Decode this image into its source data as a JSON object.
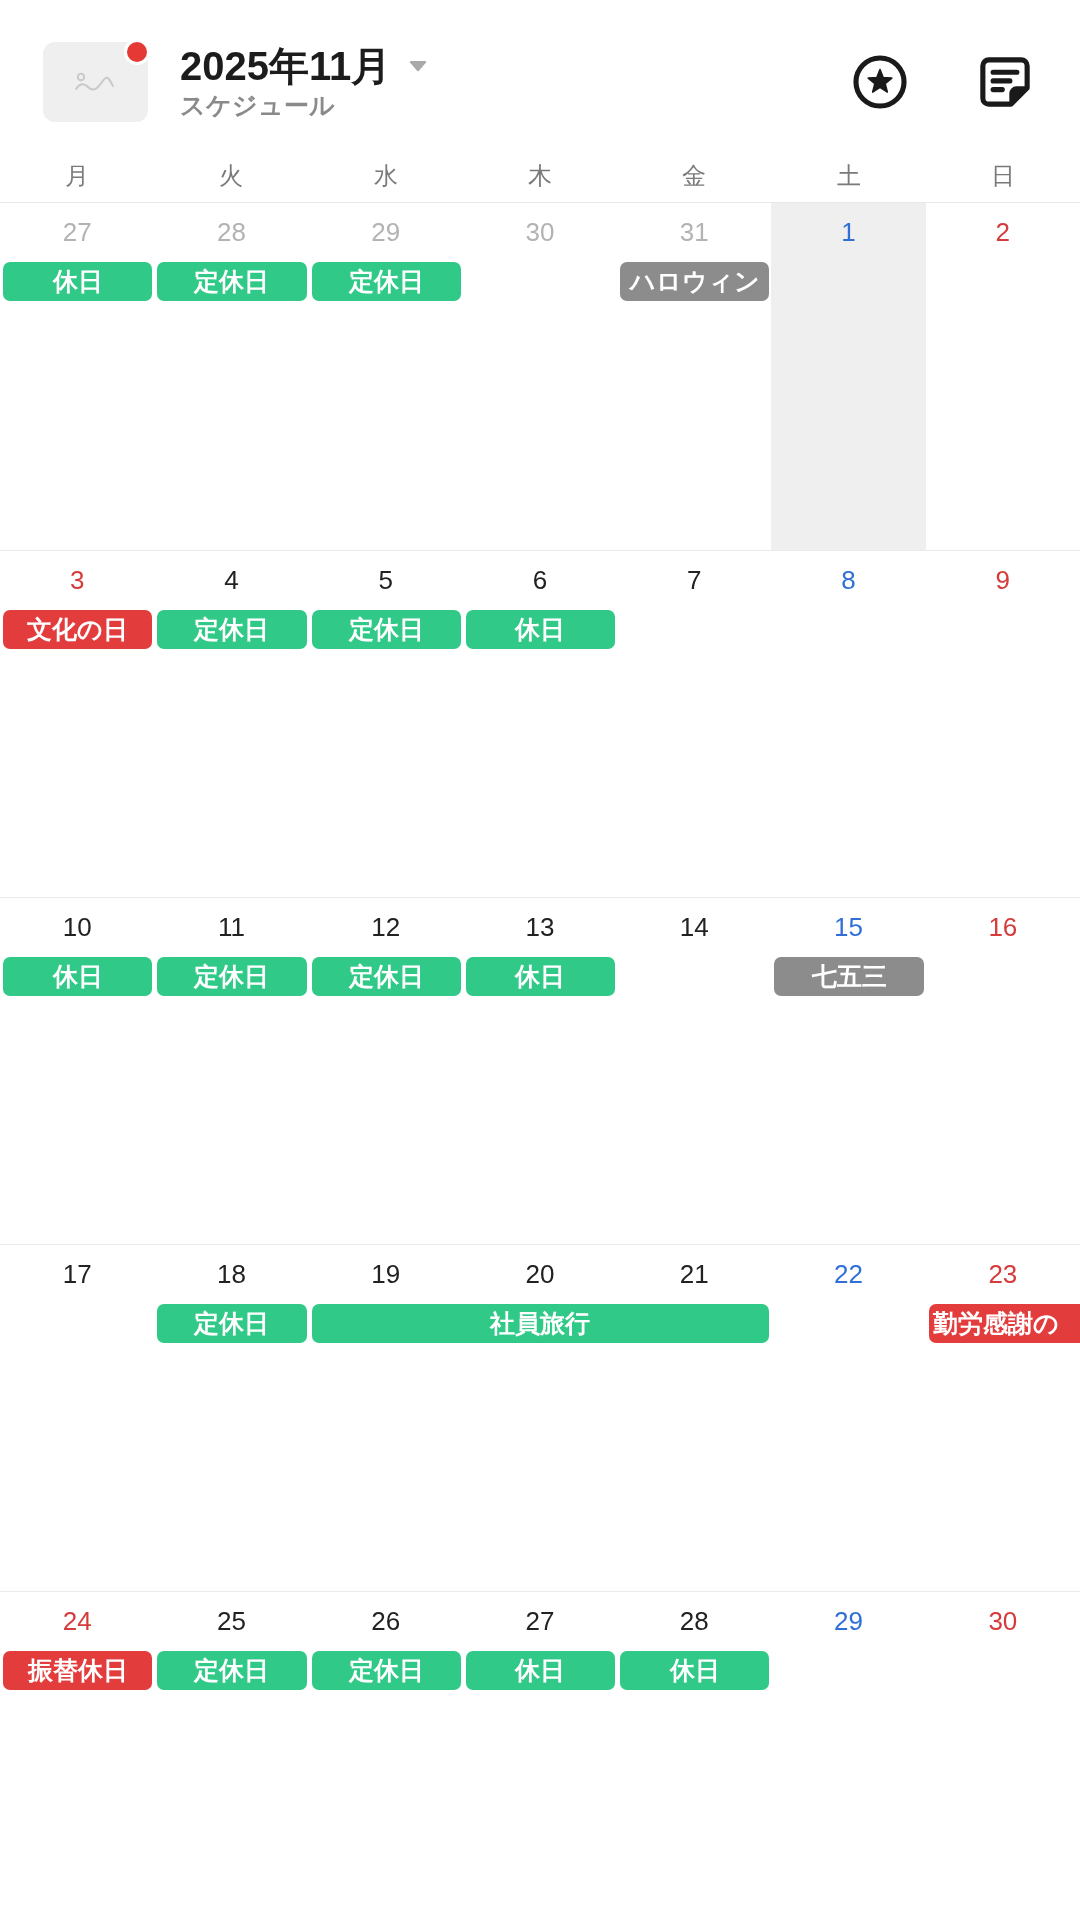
{
  "header": {
    "notification": true,
    "title": "2025年11月",
    "subtitle": "スケジュール"
  },
  "weekdays": [
    "月",
    "火",
    "水",
    "木",
    "金",
    "土",
    "日"
  ],
  "weeks": [
    {
      "days": [
        {
          "date": "27",
          "kind": "outside",
          "selected": false,
          "events": [
            {
              "kind": "single",
              "label": "休日",
              "color": "#30c987"
            }
          ]
        },
        {
          "date": "28",
          "kind": "outside",
          "selected": false,
          "events": [
            {
              "kind": "single",
              "label": "定休日",
              "color": "#30c987"
            }
          ]
        },
        {
          "date": "29",
          "kind": "outside",
          "selected": false,
          "events": [
            {
              "kind": "single",
              "label": "定休日",
              "color": "#30c987"
            }
          ]
        },
        {
          "date": "30",
          "kind": "outside",
          "selected": false
        },
        {
          "date": "31",
          "kind": "outside",
          "selected": false,
          "events": [
            {
              "kind": "single",
              "label": "ハロウィン",
              "color": "#8c8c8c"
            }
          ]
        },
        {
          "date": "1",
          "kind": "saturday",
          "selected": true
        },
        {
          "date": "2",
          "kind": "holiday",
          "selected": false
        }
      ]
    },
    {
      "days": [
        {
          "date": "3",
          "kind": "holiday",
          "selected": false,
          "events": [
            {
              "kind": "single",
              "label": "文化の日",
              "color": "#e23c3c"
            }
          ]
        },
        {
          "date": "4",
          "kind": "weekday",
          "selected": false,
          "events": [
            {
              "kind": "single",
              "label": "定休日",
              "color": "#30c987"
            }
          ]
        },
        {
          "date": "5",
          "kind": "weekday",
          "selected": false,
          "events": [
            {
              "kind": "single",
              "label": "定休日",
              "color": "#30c987"
            }
          ]
        },
        {
          "date": "6",
          "kind": "weekday",
          "selected": false,
          "events": [
            {
              "kind": "single",
              "label": "休日",
              "color": "#30c987"
            }
          ]
        },
        {
          "date": "7",
          "kind": "weekday",
          "selected": false
        },
        {
          "date": "8",
          "kind": "saturday",
          "selected": false
        },
        {
          "date": "9",
          "kind": "holiday",
          "selected": false
        }
      ]
    },
    {
      "days": [
        {
          "date": "10",
          "kind": "weekday",
          "selected": false,
          "events": [
            {
              "kind": "single",
              "label": "休日",
              "color": "#30c987"
            }
          ]
        },
        {
          "date": "11",
          "kind": "weekday",
          "selected": false,
          "events": [
            {
              "kind": "single",
              "label": "定休日",
              "color": "#30c987"
            }
          ]
        },
        {
          "date": "12",
          "kind": "weekday",
          "selected": false,
          "events": [
            {
              "kind": "single",
              "label": "定休日",
              "color": "#30c987"
            }
          ]
        },
        {
          "date": "13",
          "kind": "weekday",
          "selected": false,
          "events": [
            {
              "kind": "single",
              "label": "休日",
              "color": "#30c987"
            }
          ]
        },
        {
          "date": "14",
          "kind": "weekday",
          "selected": false
        },
        {
          "date": "15",
          "kind": "saturday",
          "selected": false,
          "events": [
            {
              "kind": "single",
              "label": "七五三",
              "color": "#8c8c8c"
            }
          ]
        },
        {
          "date": "16",
          "kind": "holiday",
          "selected": false
        }
      ]
    },
    {
      "days": [
        {
          "date": "17",
          "kind": "weekday",
          "selected": false
        },
        {
          "date": "18",
          "kind": "weekday",
          "selected": false,
          "events": [
            {
              "kind": "single",
              "label": "定休日",
              "color": "#30c987"
            }
          ]
        },
        {
          "date": "19",
          "kind": "weekday",
          "selected": false,
          "events": [
            {
              "kind": "start",
              "label": "社員旅行",
              "color": "#30c987"
            }
          ]
        },
        {
          "date": "20",
          "kind": "weekday",
          "selected": false,
          "events": [
            {
              "kind": "continued"
            }
          ]
        },
        {
          "date": "21",
          "kind": "weekday",
          "selected": false,
          "events": [
            {
              "kind": "continued"
            }
          ]
        },
        {
          "date": "22",
          "kind": "saturday",
          "selected": false
        },
        {
          "date": "23",
          "kind": "holiday",
          "selected": false,
          "events": [
            {
              "kind": "clipped",
              "label": "勤労感謝の",
              "color": "#e23c3c"
            }
          ]
        }
      ]
    },
    {
      "days": [
        {
          "date": "24",
          "kind": "holiday",
          "selected": false,
          "events": [
            {
              "kind": "single",
              "label": "振替休日",
              "color": "#e23c3c"
            }
          ]
        },
        {
          "date": "25",
          "kind": "weekday",
          "selected": false,
          "events": [
            {
              "kind": "single",
              "label": "定休日",
              "color": "#30c987"
            }
          ]
        },
        {
          "date": "26",
          "kind": "weekday",
          "selected": false,
          "events": [
            {
              "kind": "single",
              "label": "定休日",
              "color": "#30c987"
            }
          ]
        },
        {
          "date": "27",
          "kind": "weekday",
          "selected": false,
          "events": [
            {
              "kind": "single",
              "label": "休日",
              "color": "#30c987"
            }
          ]
        },
        {
          "date": "28",
          "kind": "weekday",
          "selected": false,
          "events": [
            {
              "kind": "single",
              "label": "休日",
              "color": "#30c987"
            }
          ]
        },
        {
          "date": "29",
          "kind": "saturday",
          "selected": false
        },
        {
          "date": "30",
          "kind": "holiday",
          "selected": false
        }
      ]
    }
  ]
}
